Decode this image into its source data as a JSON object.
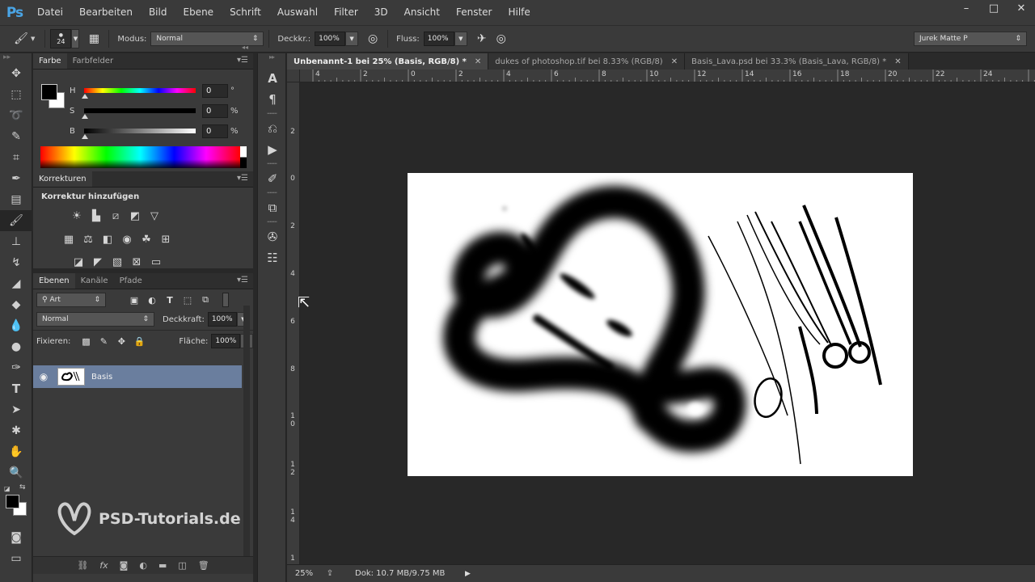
{
  "app": {
    "logo": "Ps"
  },
  "menu": [
    "Datei",
    "Bearbeiten",
    "Bild",
    "Ebene",
    "Schrift",
    "Auswahl",
    "Filter",
    "3D",
    "Ansicht",
    "Fenster",
    "Hilfe"
  ],
  "window_controls": {
    "minimize": "–",
    "maximize": "□",
    "close": "✕"
  },
  "options": {
    "brush_size": "24",
    "mode_label": "Modus:",
    "mode_value": "Normal",
    "opacity_label": "Deckkr.:",
    "opacity_value": "100%",
    "flow_label": "Fluss:",
    "flow_value": "100%",
    "workspace": "Jurek Matte P"
  },
  "color_panel": {
    "tabs": [
      "Farbe",
      "Farbfelder"
    ],
    "sliders": [
      {
        "label": "H",
        "value": "0",
        "unit": "°"
      },
      {
        "label": "S",
        "value": "0",
        "unit": "%"
      },
      {
        "label": "B",
        "value": "0",
        "unit": "%"
      }
    ],
    "fg_color": "#000000",
    "bg_color": "#ffffff"
  },
  "adjustments_panel": {
    "tab": "Korrekturen",
    "title": "Korrektur hinzufügen"
  },
  "layers_panel": {
    "tabs": [
      "Ebenen",
      "Kanäle",
      "Pfade"
    ],
    "filter_label": "Art",
    "blend_mode": "Normal",
    "opacity_label": "Deckkraft:",
    "opacity_value": "100%",
    "lock_label": "Fixieren:",
    "fill_label": "Fläche:",
    "fill_value": "100%",
    "layers": [
      {
        "name": "Basis",
        "visible": true,
        "selected": true
      }
    ],
    "selected_color": "#6a7e9e"
  },
  "watermark": "PSD-Tutorials.de",
  "documents": {
    "tabs": [
      {
        "title": "Unbenannt-1 bei 25% (Basis, RGB/8) *",
        "active": true
      },
      {
        "title": "dukes of photoshop.tif bei 8.33% (RGB/8)",
        "active": false
      },
      {
        "title": "Basis_Lava.psd bei 33.3% (Basis_Lava, RGB/8) *",
        "active": false
      }
    ]
  },
  "ruler": {
    "top": [
      "4",
      "2",
      "0",
      "2",
      "4",
      "6",
      "8",
      "10",
      "12",
      "14",
      "16",
      "18",
      "20",
      "22",
      "24"
    ],
    "left": [
      "2",
      "0",
      "2",
      "4",
      "6",
      "8",
      "10",
      "12",
      "14",
      "1"
    ]
  },
  "status": {
    "zoom": "25%",
    "doc": "Dok: 10.7 MB/9.75 MB"
  }
}
